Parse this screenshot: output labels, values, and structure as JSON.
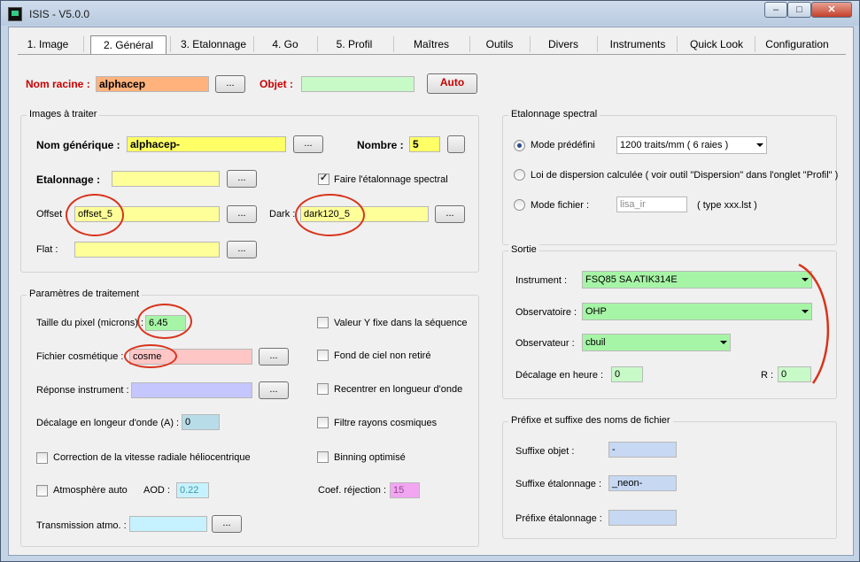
{
  "window": {
    "title": "ISIS - V5.0.0",
    "minimize": "–",
    "maximize": "□",
    "close": "✕"
  },
  "tabs": [
    "1. Image",
    "2. Général",
    "3. Etalonnage",
    "4. Go",
    "5. Profil",
    "Maîtres",
    "Outils",
    "Divers",
    "Instruments",
    "Quick Look",
    "Configuration"
  ],
  "top": {
    "nom_racine_label": "Nom racine :",
    "nom_racine_value": "alphacep",
    "browse": "...",
    "objet_label": "Objet :",
    "objet_value": "",
    "auto_label": "Auto"
  },
  "images": {
    "legend": "Images à traiter",
    "generic_label": "Nom générique :",
    "generic_value": "alphacep-",
    "nombre_label": "Nombre :",
    "nombre_value": "5",
    "etal_label": "Etalonnage :",
    "etal_value": "",
    "faire_label": "Faire l'étalonnage spectral",
    "faire_checked": true,
    "offset_label": "Offset :",
    "offset_value": "offset_5",
    "dark_label": "Dark :",
    "dark_value": "dark120_5",
    "flat_label": "Flat :",
    "flat_value": ""
  },
  "params": {
    "legend": "Paramètres de traitement",
    "pixel_label": "Taille du pixel (microns) :",
    "pixel_value": "6.45",
    "cosm_label": "Fichier cosmétique :",
    "cosm_value": "cosme",
    "rep_label": "Réponse instrument :",
    "rep_value": "",
    "dec_label": "Décalage en longeur d'onde (A) :",
    "dec_value": "0",
    "vitesse_label": "Correction de la vitesse radiale héliocentrique",
    "atm_label": "Atmosphère auto",
    "aod_label": "AOD :",
    "aod_value": "0.22",
    "trans_label": "Transmission atmo. :",
    "trans_value": "",
    "yfixe_label": "Valeur Y fixe dans la séquence",
    "fond_label": "Fond de ciel non retiré",
    "recentrer_label": "Recentrer en longueur d'onde",
    "filtre_label": "Filtre rayons cosmiques",
    "binning_label": "Binning optimisé",
    "coef_label": "Coef. réjection :",
    "coef_value": "15"
  },
  "etalonnage": {
    "legend": "Etalonnage spectral",
    "mode_predef_label": "Mode prédéfini",
    "mode_predef_value": "1200 traits/mm ( 6 raies )",
    "loi_label": "Loi de dispersion calculée ( voir outil \"Dispersion\" dans l'onglet \"Profil\" )",
    "mode_fichier_label": "Mode fichier :",
    "mode_fichier_value": "lisa_ir",
    "type_label": "( type xxx.lst )"
  },
  "sortie": {
    "legend": "Sortie",
    "instrument_label": "Instrument :",
    "instrument_value": "FSQ85 SA ATIK314E",
    "observatoire_label": "Observatoire :",
    "observatoire_value": "OHP",
    "observateur_label": "Observateur :",
    "observateur_value": "cbuil",
    "decalage_label": "Décalage en heure :",
    "decalage_value": "0",
    "r_label": "R :",
    "r_value": "0"
  },
  "prefix": {
    "legend": "Préfixe et suffixe des noms de fichier",
    "suffixe_objet_label": "Suffixe objet :",
    "suffixe_objet_value": "-",
    "suffixe_etal_label": "Suffixe étalonnage :",
    "suffixe_etal_value": "_neon-",
    "prefixe_etal_label": "Préfixe étalonnage :",
    "prefixe_etal_value": ""
  },
  "colors": {
    "annotation": "#d8341c",
    "yellow": "#ffff66",
    "green": "#a6f5a6",
    "orange": "#ffb27c"
  }
}
